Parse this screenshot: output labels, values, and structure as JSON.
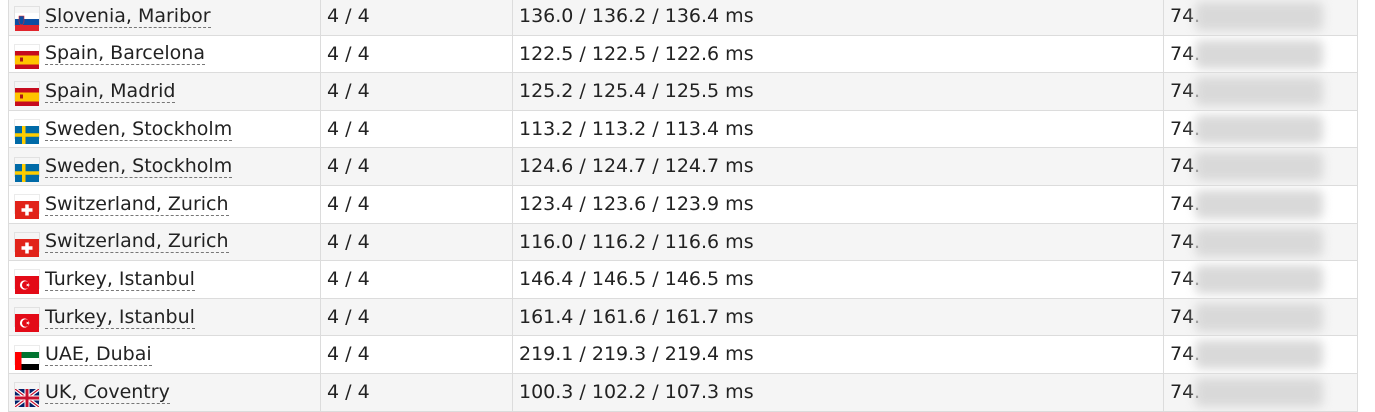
{
  "rows": [
    {
      "location": "Slovenia, Maribor",
      "flag_icon": "slovenia-flag-icon",
      "packets": "4 / 4",
      "rtt": "136.0 / 136.2 / 136.4 ms",
      "ip_prefix": "74."
    },
    {
      "location": "Spain, Barcelona",
      "flag_icon": "spain-flag-icon",
      "packets": "4 / 4",
      "rtt": "122.5 / 122.5 / 122.6 ms",
      "ip_prefix": "74."
    },
    {
      "location": "Spain, Madrid",
      "flag_icon": "spain-flag-icon",
      "packets": "4 / 4",
      "rtt": "125.2 / 125.4 / 125.5 ms",
      "ip_prefix": "74."
    },
    {
      "location": "Sweden, Stockholm",
      "flag_icon": "sweden-flag-icon",
      "packets": "4 / 4",
      "rtt": "113.2 / 113.2 / 113.4 ms",
      "ip_prefix": "74."
    },
    {
      "location": "Sweden, Stockholm",
      "flag_icon": "sweden-flag-icon",
      "packets": "4 / 4",
      "rtt": "124.6 / 124.7 / 124.7 ms",
      "ip_prefix": "74."
    },
    {
      "location": "Switzerland, Zurich",
      "flag_icon": "switzerland-flag-icon",
      "packets": "4 / 4",
      "rtt": "123.4 / 123.6 / 123.9 ms",
      "ip_prefix": "74."
    },
    {
      "location": "Switzerland, Zurich",
      "flag_icon": "switzerland-flag-icon",
      "packets": "4 / 4",
      "rtt": "116.0 / 116.2 / 116.6 ms",
      "ip_prefix": "74."
    },
    {
      "location": "Turkey, Istanbul",
      "flag_icon": "turkey-flag-icon",
      "packets": "4 / 4",
      "rtt": "146.4 / 146.5 / 146.5 ms",
      "ip_prefix": "74."
    },
    {
      "location": "Turkey, Istanbul",
      "flag_icon": "turkey-flag-icon",
      "packets": "4 / 4",
      "rtt": "161.4 / 161.6 / 161.7 ms",
      "ip_prefix": "74."
    },
    {
      "location": "UAE, Dubai",
      "flag_icon": "uae-flag-icon",
      "packets": "4 / 4",
      "rtt": "219.1 / 219.3 / 219.4 ms",
      "ip_prefix": "74."
    },
    {
      "location": "UK, Coventry",
      "flag_icon": "uk-flag-icon",
      "packets": "4 / 4",
      "rtt": "100.3 / 102.2 / 107.3 ms",
      "ip_prefix": "74."
    }
  ],
  "colors": {
    "row_odd": "#f5f5f5",
    "row_even": "#ffffff",
    "border": "#dcdcdc"
  }
}
